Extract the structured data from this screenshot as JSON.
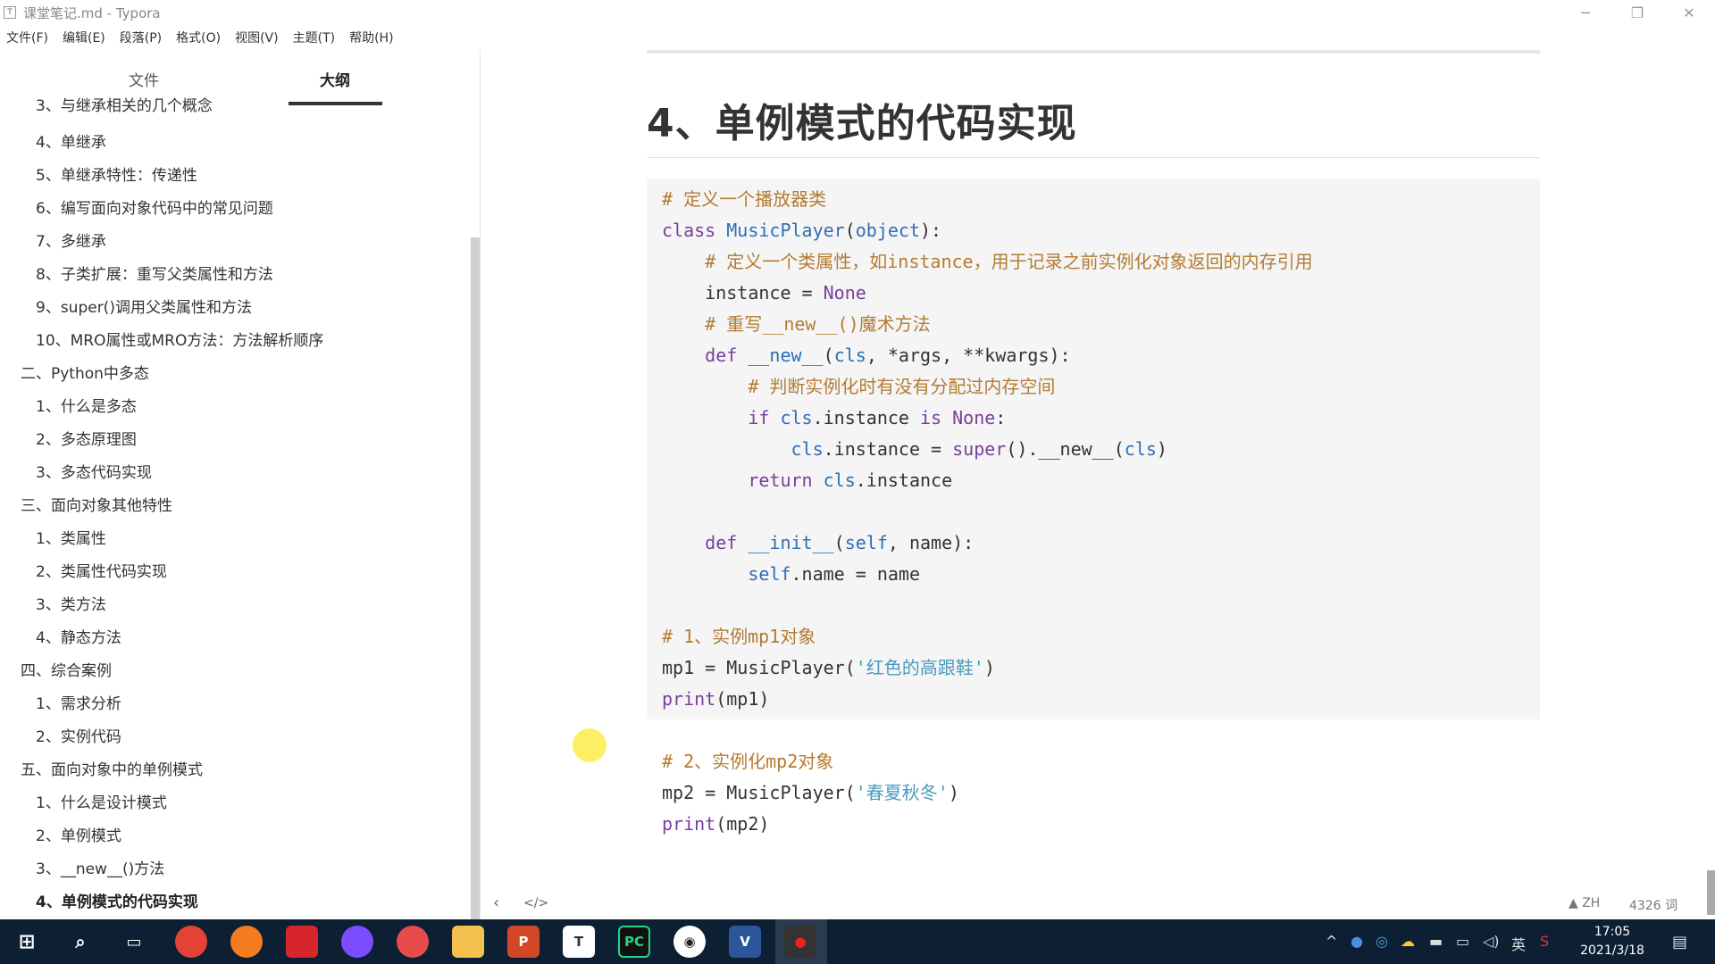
{
  "window": {
    "title": "课堂笔记.md - Typora",
    "minimize": "─",
    "restore": "❐",
    "close": "✕"
  },
  "menu": [
    "文件(F)",
    "编辑(E)",
    "段落(P)",
    "格式(O)",
    "视图(V)",
    "主题(T)",
    "帮助(H)"
  ],
  "sidebar": {
    "tabs": [
      "文件",
      "大纲"
    ],
    "active_tab": "大纲",
    "outline": [
      {
        "text": "3、与继承相关的几个概念",
        "level": 2
      },
      {
        "text": "4、单继承",
        "level": 2
      },
      {
        "text": "5、单继承特性：传递性",
        "level": 2
      },
      {
        "text": "6、编写面向对象代码中的常见问题",
        "level": 2
      },
      {
        "text": "7、多继承",
        "level": 2
      },
      {
        "text": "8、子类扩展：重写父类属性和方法",
        "level": 2
      },
      {
        "text": "9、super()调用父类属性和方法",
        "level": 2
      },
      {
        "text": "10、MRO属性或MRO方法：方法解析顺序",
        "level": 2
      },
      {
        "text": "二、Python中多态",
        "level": 1
      },
      {
        "text": "1、什么是多态",
        "level": 2
      },
      {
        "text": "2、多态原理图",
        "level": 2
      },
      {
        "text": "3、多态代码实现",
        "level": 2
      },
      {
        "text": "三、面向对象其他特性",
        "level": 1
      },
      {
        "text": "1、类属性",
        "level": 2
      },
      {
        "text": "2、类属性代码实现",
        "level": 2
      },
      {
        "text": "3、类方法",
        "level": 2
      },
      {
        "text": "4、静态方法",
        "level": 2
      },
      {
        "text": "四、综合案例",
        "level": 1
      },
      {
        "text": "1、需求分析",
        "level": 2
      },
      {
        "text": "2、实例代码",
        "level": 2
      },
      {
        "text": "五、面向对象中的单例模式",
        "level": 1
      },
      {
        "text": "1、什么是设计模式",
        "level": 2
      },
      {
        "text": "2、单例模式",
        "level": 2
      },
      {
        "text": "3、__new__()方法",
        "level": 2
      },
      {
        "text": "4、单例模式的代码实现",
        "level": 2,
        "active": true
      }
    ]
  },
  "document": {
    "heading": "4、单例模式的代码实现",
    "code": [
      [
        [
          "cm",
          "# 定义一个播放器类"
        ]
      ],
      [
        [
          "kw",
          "class "
        ],
        [
          "cls",
          "MusicPlayer"
        ],
        [
          "",
          "("
        ],
        [
          "cls",
          "object"
        ],
        [
          "",
          "):"
        ]
      ],
      [
        [
          "",
          "    "
        ],
        [
          "cm",
          "# 定义一个类属性，如instance，用于记录之前实例化对象返回的内存引用"
        ]
      ],
      [
        [
          "",
          "    instance = "
        ],
        [
          "kw",
          "None"
        ]
      ],
      [
        [
          "",
          "    "
        ],
        [
          "cm",
          "# 重写__new__()魔术方法"
        ]
      ],
      [
        [
          "",
          "    "
        ],
        [
          "kw",
          "def "
        ],
        [
          "cls",
          "__new__"
        ],
        [
          "",
          "("
        ],
        [
          "cls",
          "cls"
        ],
        [
          "",
          ", *args, **kwargs):"
        ]
      ],
      [
        [
          "",
          "        "
        ],
        [
          "cm",
          "# 判断实例化时有没有分配过内存空间"
        ]
      ],
      [
        [
          "",
          "        "
        ],
        [
          "kw",
          "if "
        ],
        [
          "cls",
          "cls"
        ],
        [
          "",
          ".instance "
        ],
        [
          "kw",
          "is None"
        ],
        [
          "",
          ":"
        ]
      ],
      [
        [
          "",
          "            "
        ],
        [
          "cls",
          "cls"
        ],
        [
          "",
          ".instance = "
        ],
        [
          "kw",
          "super"
        ],
        [
          "",
          "().__new__("
        ],
        [
          "cls",
          "cls"
        ],
        [
          "",
          ")"
        ]
      ],
      [
        [
          "",
          "        "
        ],
        [
          "kw",
          "return "
        ],
        [
          "cls",
          "cls"
        ],
        [
          "",
          ".instance"
        ]
      ],
      [
        [
          "",
          ""
        ]
      ],
      [
        [
          "",
          "    "
        ],
        [
          "kw",
          "def "
        ],
        [
          "cls",
          "__init__"
        ],
        [
          "",
          "("
        ],
        [
          "cls",
          "self"
        ],
        [
          "",
          ", name):"
        ]
      ],
      [
        [
          "",
          "        "
        ],
        [
          "cls",
          "self"
        ],
        [
          "",
          ".name = name"
        ]
      ],
      [
        [
          "",
          ""
        ]
      ],
      [
        [
          "cm",
          "# 1、实例mp1对象"
        ]
      ],
      [
        [
          "",
          "mp1 = MusicPlayer("
        ],
        [
          "str",
          "'红色的高跟鞋'"
        ],
        [
          "",
          ")"
        ]
      ],
      [
        [
          "kw",
          "print"
        ],
        [
          "",
          "(mp1)"
        ]
      ],
      [
        [
          "",
          ""
        ]
      ],
      [
        [
          "cm",
          "# 2、实例化mp2对象"
        ]
      ],
      [
        [
          "",
          "mp2 = MusicPlayer("
        ],
        [
          "str",
          "'春夏秋冬'"
        ],
        [
          "",
          ")"
        ]
      ],
      [
        [
          "kw",
          "print"
        ],
        [
          "",
          "(mp2)"
        ]
      ]
    ]
  },
  "footer": {
    "back": "‹",
    "source_toggle": "</>",
    "lang": "▲ ZH",
    "word_count": "4326 词"
  },
  "taskbar": {
    "time": "17:05",
    "date": "2021/3/18",
    "ime": "英",
    "notif": "1"
  }
}
